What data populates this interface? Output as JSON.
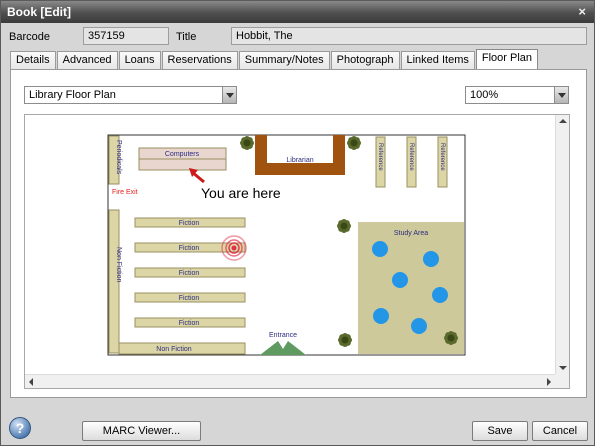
{
  "window": {
    "title": "Book [Edit]",
    "close_glyph": "×"
  },
  "fields": {
    "barcode_label": "Barcode",
    "barcode_value": "357159",
    "title_label": "Title",
    "title_value": "Hobbit, The"
  },
  "tabs": [
    {
      "label": "Details",
      "active": false
    },
    {
      "label": "Advanced",
      "active": false
    },
    {
      "label": "Loans",
      "active": false
    },
    {
      "label": "Reservations",
      "active": false
    },
    {
      "label": "Summary/Notes",
      "active": false
    },
    {
      "label": "Photograph",
      "active": false
    },
    {
      "label": "Linked Items",
      "active": false
    },
    {
      "label": "Floor Plan",
      "active": true
    }
  ],
  "floorplan": {
    "map_select": "Library Floor Plan",
    "zoom_select": "100%",
    "labels": {
      "computers": "Computers",
      "librarian": "Librarian",
      "periodicals": "Periodicals",
      "fire_exit": "Fire Exit",
      "you_are_here": "You are here",
      "fiction": "Fiction",
      "non_fiction": "Non Fiction",
      "study_area": "Study Area",
      "entrance": "Entrance",
      "reference": "Reference"
    },
    "colors": {
      "shelf": "#dcd6a6",
      "shelf_border": "#9a9060",
      "study": "#cdc99a",
      "librarian_desk": "#a0530e",
      "computers": "#e8d6cf",
      "table": "#2396e8",
      "plant": "#5a6a2c",
      "entrance": "#5f9a61",
      "marker": "#e0304a",
      "fire_exit": "#e22222",
      "label_blue": "#2c2c80"
    }
  },
  "footer": {
    "marc_label": "MARC Viewer...",
    "save_label": "Save",
    "cancel_label": "Cancel",
    "help_glyph": "?"
  }
}
